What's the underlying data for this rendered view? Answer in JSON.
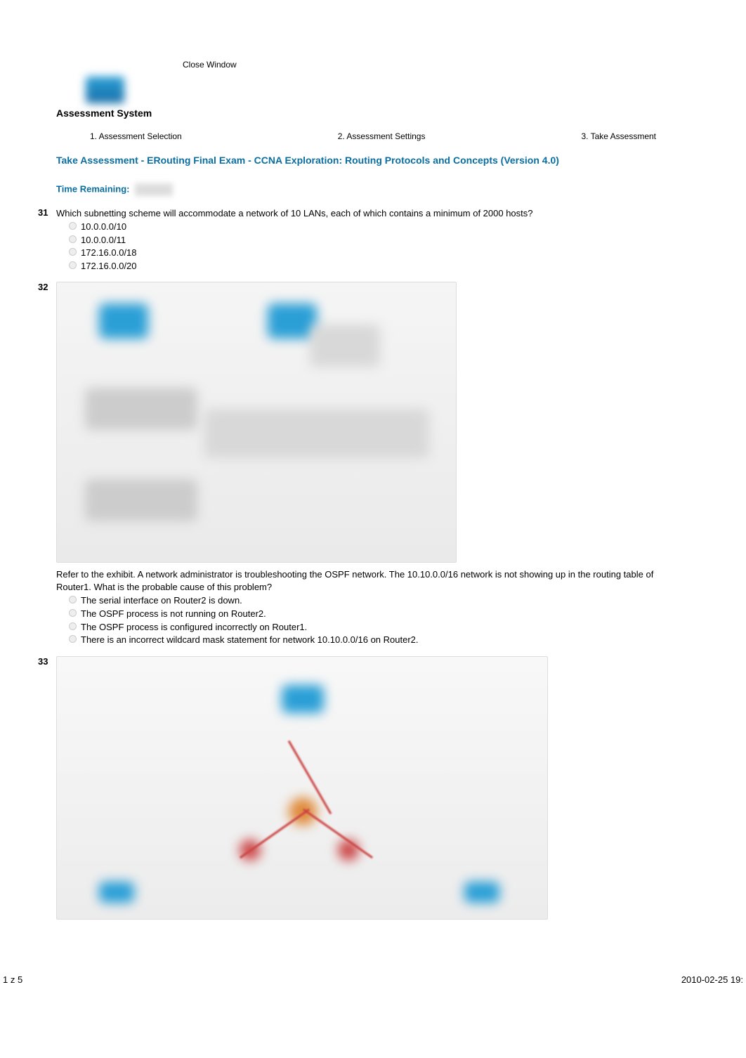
{
  "close_window": "Close Window",
  "system_title": "Assessment System",
  "steps": {
    "s1": "1. Assessment Selection",
    "s2": "2. Assessment Settings",
    "s3": "3. Take Assessment"
  },
  "assessment_title": "Take Assessment - ERouting Final Exam - CCNA Exploration: Routing Protocols and Concepts (Version 4.0)",
  "time_remaining_label": "Time Remaining:",
  "questions": {
    "q31": {
      "num": "31",
      "text": "Which subnetting scheme will accommodate a network of 10 LANs, each of which contains a minimum of 2000 hosts?",
      "options": [
        "10.0.0.0/10",
        "10.0.0.0/11",
        "172.16.0.0/18",
        "172.16.0.0/20"
      ]
    },
    "q32": {
      "num": "32",
      "text": "Refer to the exhibit. A network administrator is troubleshooting the OSPF network. The 10.10.0.0/16 network is not showing up in the routing table of Router1. What is the probable cause of this problem?",
      "options": [
        "The serial interface on Router2 is down.",
        "The OSPF process is not running on Router2.",
        "The OSPF process is configured incorrectly on Router1.",
        "There is an incorrect wildcard mask statement for network 10.10.0.0/16 on Router2."
      ]
    },
    "q33": {
      "num": "33"
    }
  },
  "footer": {
    "left": "1 z 5",
    "right": "2010-02-25 19:"
  }
}
